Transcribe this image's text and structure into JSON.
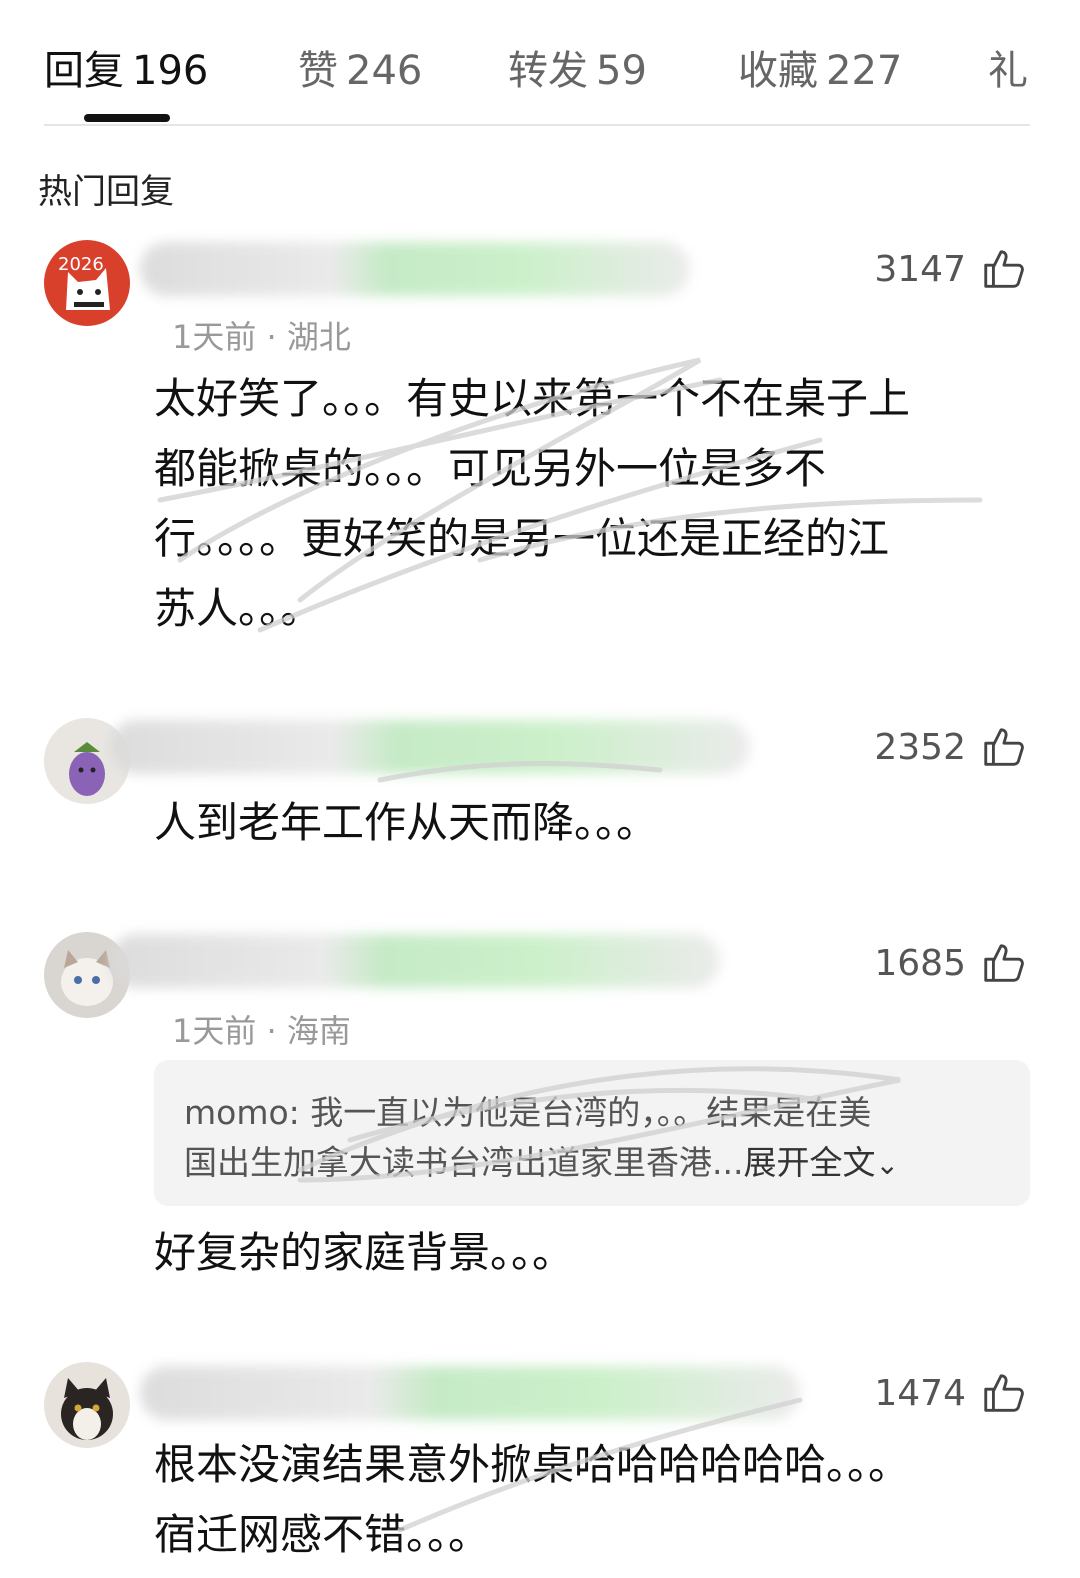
{
  "tabs": [
    {
      "label": "回复",
      "count": "196"
    },
    {
      "label": "赞",
      "count": "246"
    },
    {
      "label": "转发",
      "count": "59"
    },
    {
      "label": "收藏",
      "count": "227"
    },
    {
      "label": "礼",
      "count": ""
    }
  ],
  "section_title": "热门回复",
  "comments": [
    {
      "meta": "1天前 · 湖北",
      "likes": "3147",
      "lines": [
        "太好笑了。。。有史以来第一个不在桌子上",
        "都能掀桌的。。。可见另外一位是多不",
        "行。。。。更好笑的是另一位还是正经的江",
        "苏人。。。"
      ]
    },
    {
      "meta": "",
      "likes": "2352",
      "lines": [
        "人到老年工作从天而降。。。"
      ]
    },
    {
      "meta": "1天前 · 海南",
      "likes": "1685",
      "quote": {
        "line1": "momo: 我一直以为他是台湾的，。。结果是在美",
        "line2": "国出生加拿大读书台湾出道家里香港...",
        "expand": "展开全文"
      },
      "lines": [
        "好复杂的家庭背景。。。"
      ]
    },
    {
      "meta": "",
      "likes": "1474",
      "lines": [
        "根本没演结果意外掀桌哈哈哈哈哈哈。。。",
        "宿迁网感不错。。。"
      ]
    }
  ],
  "colors": {
    "active_tab": "#111111",
    "inactive_tab": "#666666",
    "meta": "#999999",
    "quote_bg": "#f3f3f3"
  }
}
